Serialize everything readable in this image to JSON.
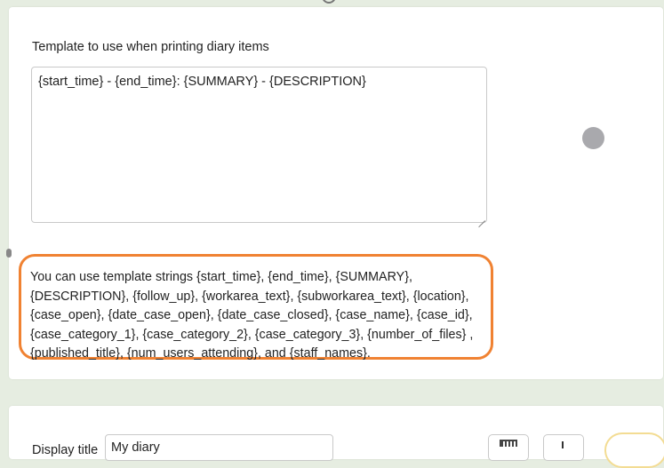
{
  "settings": {
    "template_label": "Template to use when printing diary items",
    "template_value": "{start_time} - {end_time}: {SUMMARY} - {DESCRIPTION}",
    "help_text": "You can use template strings {start_time}, {end_time}, {SUMMARY}, {DESCRIPTION}, {follow_up}, {workarea_text}, {subworkarea_text}, {location}, {case_open}, {date_case_open}, {date_case_closed}, {case_name}, {case_id}, {case_category_1}, {case_category_2}, {case_category_3}, {number_of_files} , {published_title}, {num_users_attending}, and {staff_names}."
  },
  "next_section": {
    "display_title_label": "Display title",
    "display_title_value": "My diary"
  },
  "colors": {
    "page_background": "#e6ede1",
    "highlight_border": "#f08232",
    "status_dot": "#a9a9ad"
  },
  "icons": [
    "printer-icon",
    "arrow-up-icon"
  ]
}
